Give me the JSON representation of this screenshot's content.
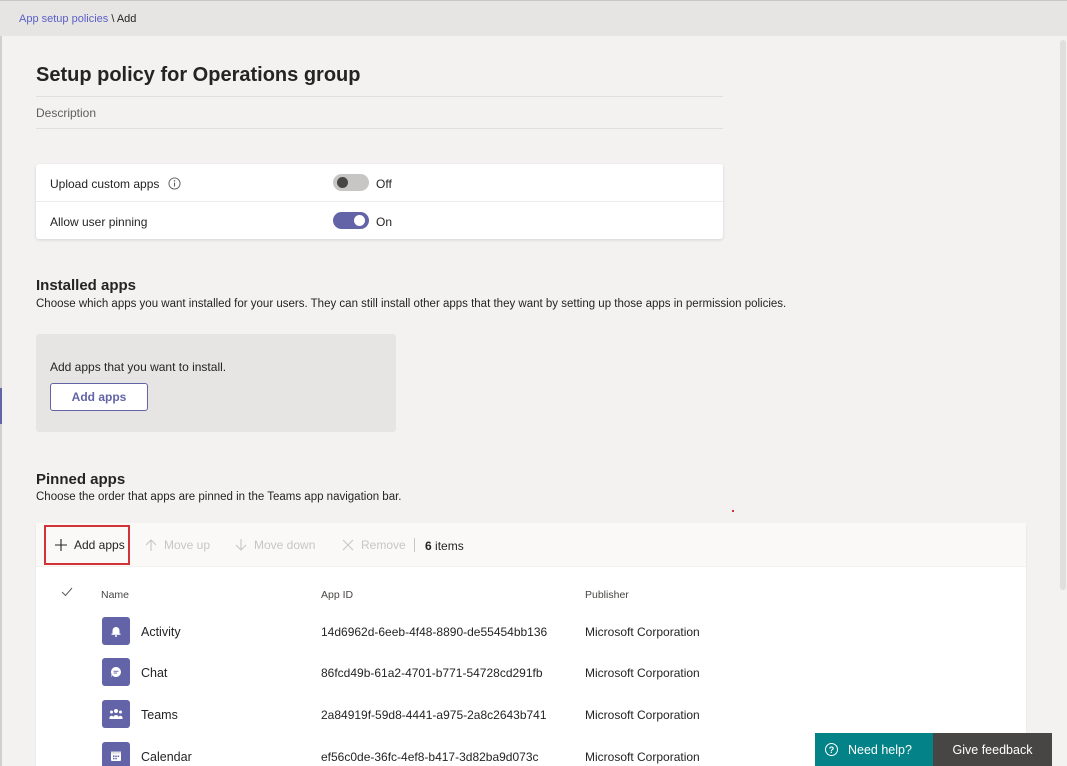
{
  "breadcrumb": {
    "parent": "App setup policies",
    "separator": " \\ ",
    "current": "Add"
  },
  "page": {
    "title": "Setup policy for Operations group",
    "description_label": "Description"
  },
  "settings": [
    {
      "label": "Upload custom apps",
      "state": "Off",
      "enabled": false,
      "has_info_icon": true
    },
    {
      "label": "Allow user pinning",
      "state": "On",
      "enabled": true,
      "has_info_icon": false
    }
  ],
  "installed": {
    "title": "Installed apps",
    "subtitle": "Choose which apps you want installed for your users. They can still install other apps that they want by setting up those apps in permission policies.",
    "box_text": "Add apps that you want to install.",
    "button": "Add apps"
  },
  "pinned": {
    "title": "Pinned apps",
    "subtitle": "Choose the order that apps are pinned in the Teams app navigation bar.",
    "toolbar": {
      "add": "Add apps",
      "move_up": "Move up",
      "move_down": "Move down",
      "remove": "Remove",
      "count_number": "6",
      "count_word": "items"
    },
    "columns": {
      "name": "Name",
      "app_id": "App ID",
      "publisher": "Publisher"
    },
    "rows": [
      {
        "name": "Activity",
        "app_id": "14d6962d-6eeb-4f48-8890-de55454bb136",
        "publisher": "Microsoft Corporation",
        "icon": "bell-icon"
      },
      {
        "name": "Chat",
        "app_id": "86fcd49b-61a2-4701-b771-54728cd291fb",
        "publisher": "Microsoft Corporation",
        "icon": "chat-icon"
      },
      {
        "name": "Teams",
        "app_id": "2a84919f-59d8-4441-a975-2a8c2643b741",
        "publisher": "Microsoft Corporation",
        "icon": "teams-icon"
      },
      {
        "name": "Calendar",
        "app_id": "ef56c0de-36fc-4ef8-b417-3d82ba9d073c",
        "publisher": "Microsoft Corporation",
        "icon": "calendar-icon"
      }
    ]
  },
  "footer": {
    "help": "Need help?",
    "feedback": "Give feedback"
  },
  "colors": {
    "accent": "#6264a7",
    "help_bg": "#038387",
    "feedback_bg": "#484644",
    "highlight": "#d13438"
  }
}
